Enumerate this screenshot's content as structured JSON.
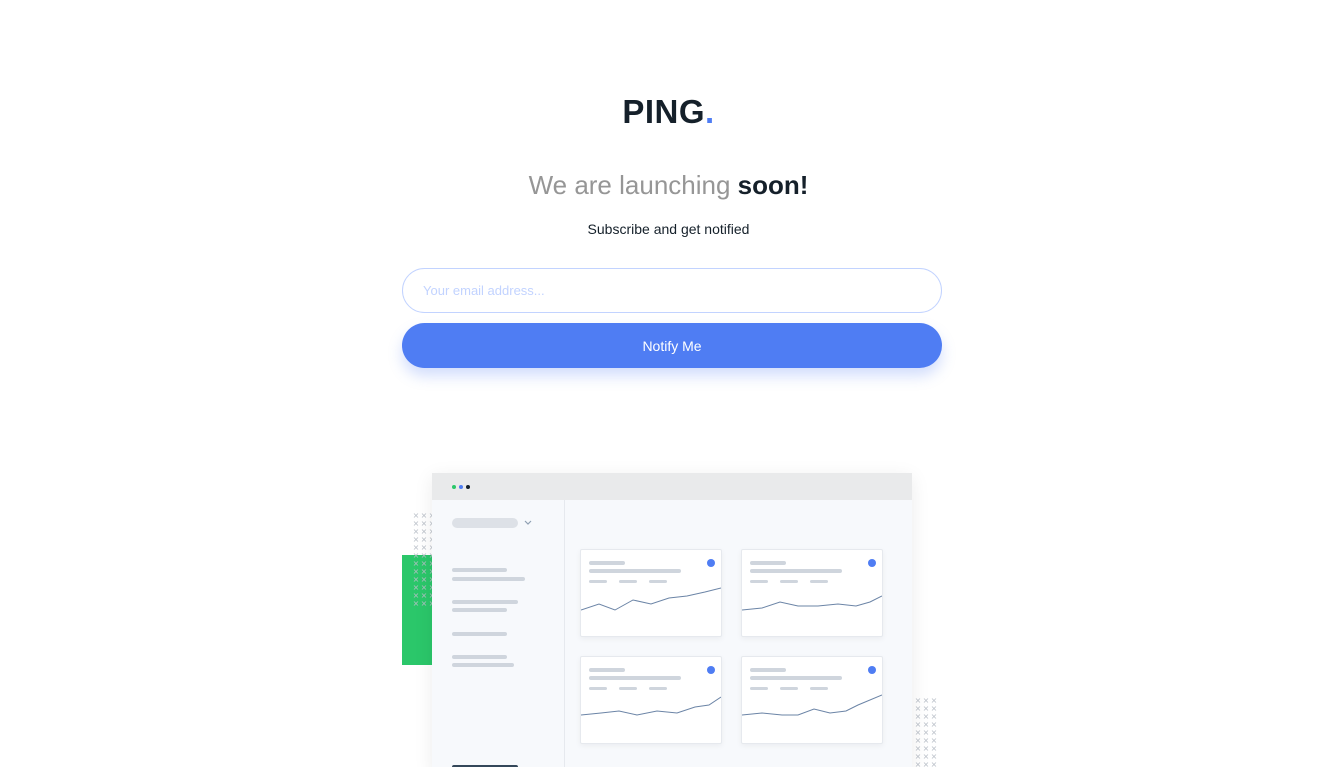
{
  "brand": {
    "name": "PING",
    "dot": "."
  },
  "hero": {
    "headline_light": "We are launching ",
    "headline_bold": "soon!",
    "subline": "Subscribe and get notified"
  },
  "form": {
    "email_placeholder": "Your email address...",
    "email_value": "",
    "submit_label": "Notify Me"
  },
  "illustration": {
    "sidebar_badge": "slack",
    "icons": [
      "chevron-down-icon",
      "check-circle-icon",
      "x-pattern-icon"
    ]
  },
  "colors": {
    "accent": "#4f7df3",
    "dark": "#15202a",
    "gray": "#969696",
    "input_border": "#c2d3ff",
    "green": "#2bc76a"
  }
}
